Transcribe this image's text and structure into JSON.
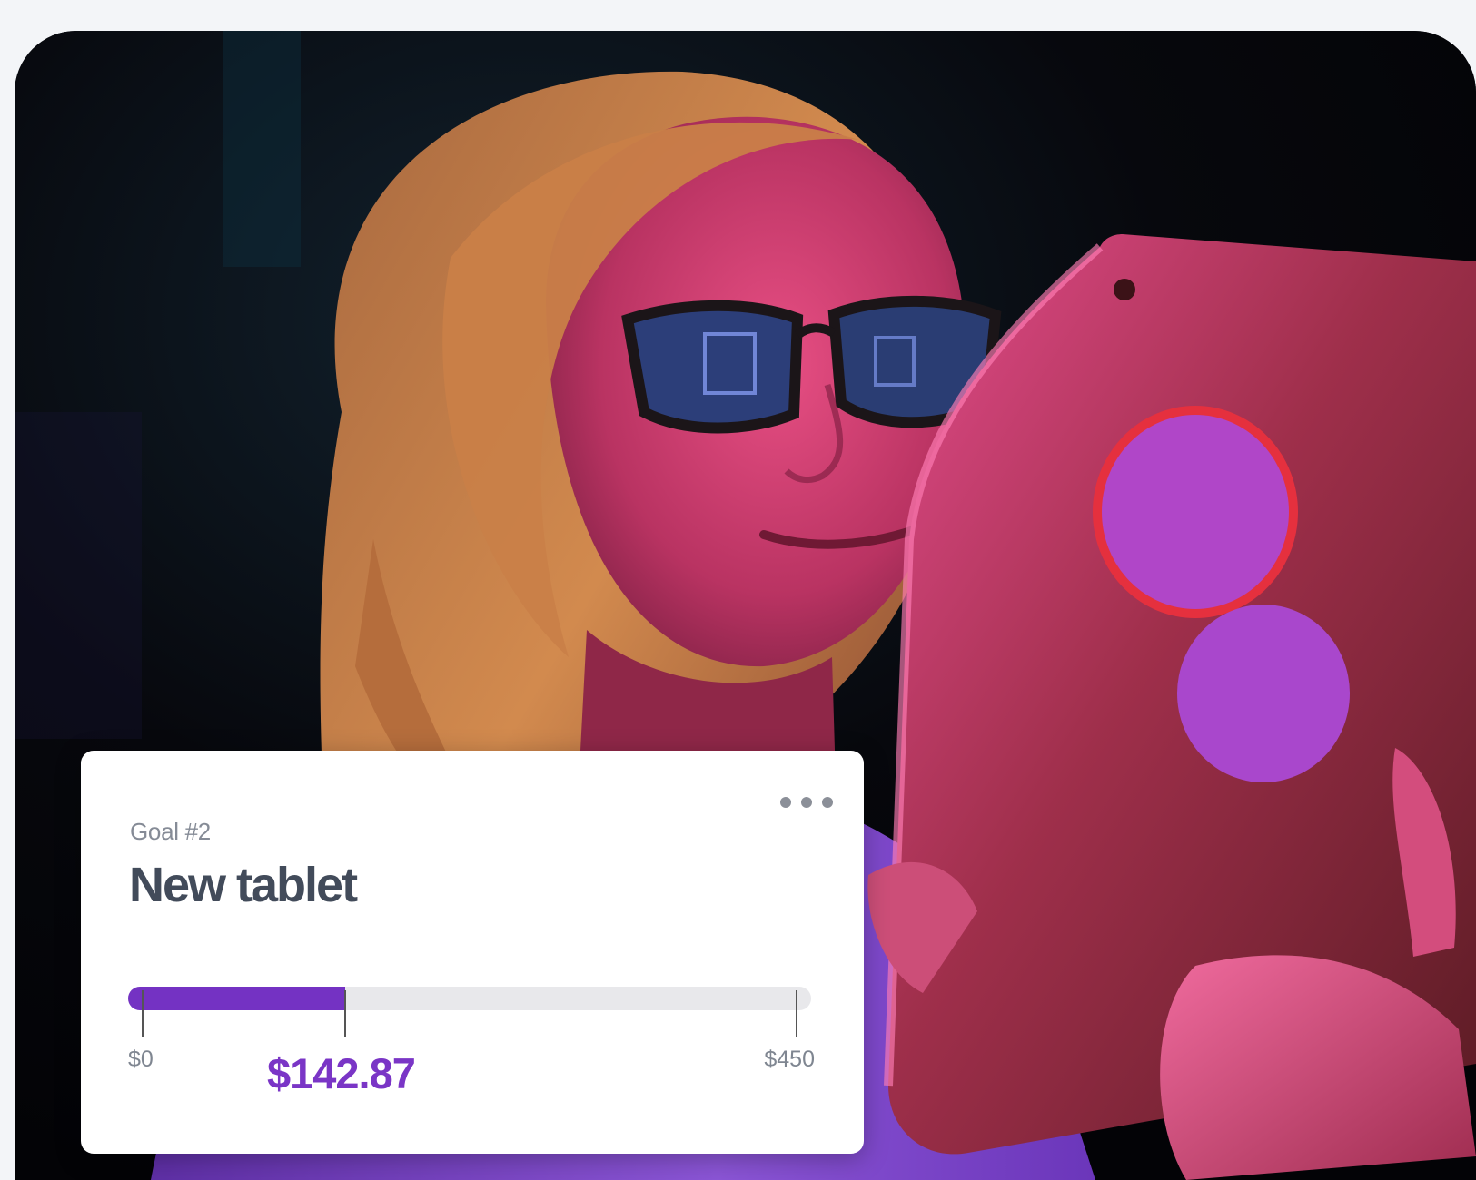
{
  "goal_card": {
    "kicker": "Goal #2",
    "title": "New tablet",
    "progress": {
      "min_label": "$0",
      "max_label": "$450",
      "current_label": "$142.87",
      "current_value": 142.87,
      "max_value": 450
    }
  },
  "colors": {
    "accent": "#7432c3",
    "track": "#e8e8eb",
    "title": "#424b5a"
  },
  "icons": {
    "more": "more-horizontal-icon"
  }
}
